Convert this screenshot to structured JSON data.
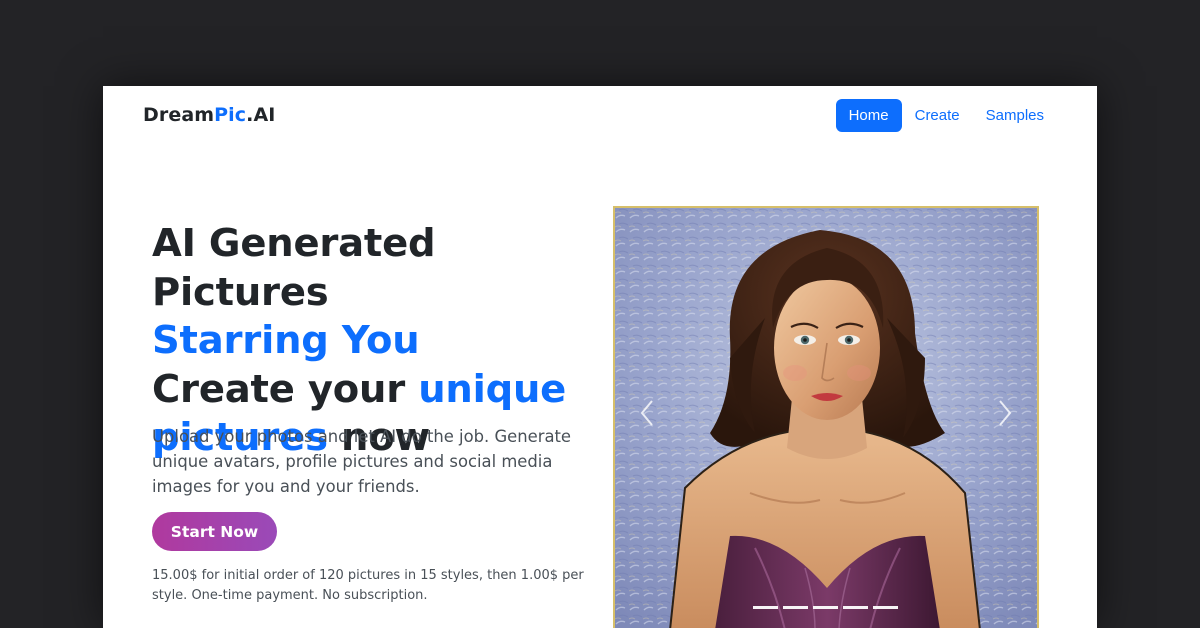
{
  "navbar": {
    "brand": {
      "part1": "Dream",
      "part2": "Pic",
      "part3": ".AI"
    },
    "links": [
      {
        "label": "Home",
        "active": true
      },
      {
        "label": "Create",
        "active": false
      },
      {
        "label": "Samples",
        "active": false
      }
    ]
  },
  "hero": {
    "heading": {
      "line1": "AI Generated Pictures",
      "line2": "Starring You",
      "line3_plain": "Create your ",
      "line3_accent": "unique",
      "line4_accent": "pictures",
      "line4_plain": " now"
    },
    "description": "Upload your photos and let AI do the job. Generate unique avatars, profile pictures and social media images for you and your friends.",
    "cta_label": "Start Now",
    "pricing_note": "15.00$ for initial order of 120 pictures in 15 styles, then 1.00$ per style. One-time payment. No subscription."
  },
  "carousel": {
    "prev_icon": "chevron-left-icon",
    "next_icon": "chevron-right-icon",
    "slide_count": 5,
    "active_slide": 1
  },
  "colors": {
    "accent": "#0d6efd",
    "text": "#212529",
    "muted": "#495057",
    "cta_gradient_start": "#b0399e",
    "cta_gradient_end": "#9a4ab8",
    "backdrop": "#232326",
    "frame": "#d6bf6a"
  }
}
